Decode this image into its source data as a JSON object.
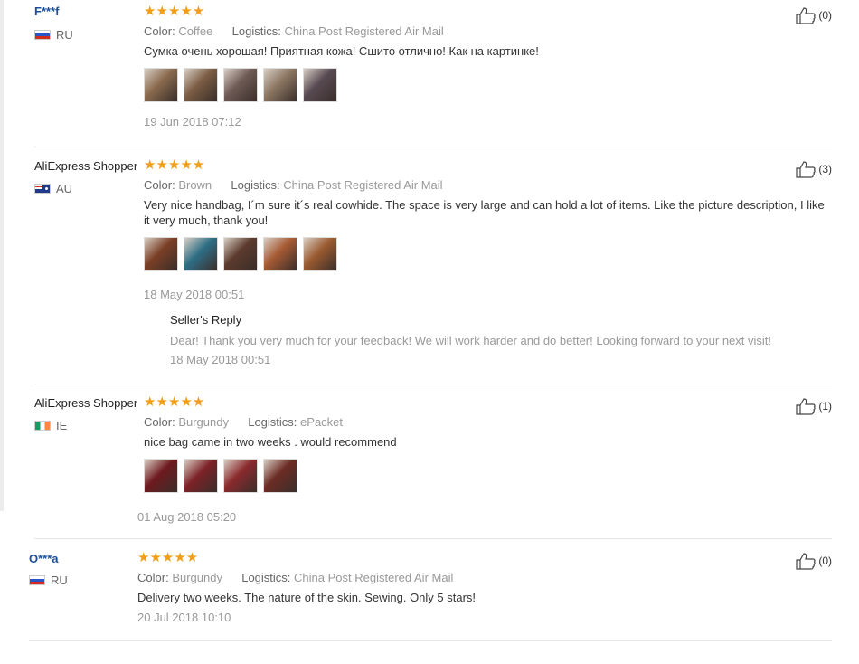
{
  "labels": {
    "color": "Color:",
    "logistics": "Logistics:"
  },
  "reviews": [
    {
      "user": "F***f",
      "country": "RU",
      "stars": "★★★★★",
      "color": "Coffee",
      "logistics": "China Post Registered Air Mail",
      "content": "Сумка очень хорошая! Приятная кожа! Сшито отлично! Как на картинке!",
      "date": "19 Jun 2018 07:12",
      "likes": "(0)",
      "photos": [
        "#8a6a4e",
        "#7b5c43",
        "#6e5a55",
        "#8c7763",
        "#584a52"
      ]
    },
    {
      "user": "AliExpress Shopper",
      "country": "AU",
      "stars": "★★★★★",
      "color": "Brown",
      "logistics": "China Post Registered Air Mail",
      "content": "Very nice handbag, I´m sure it´s real cowhide. The space is very large and can hold a lot of items. Like the picture description, I like it very much, thank you!",
      "date": "18 May 2018 00:51",
      "likes": "(3)",
      "photos": [
        "#7a3f25",
        "#2e6f86",
        "#5b3a2c",
        "#a55a33",
        "#9b5b30"
      ],
      "seller_reply": {
        "title": "Seller's Reply",
        "text": "Dear! Thank you very much for your feedback! We will work harder and do better! Looking forward to your next visit!",
        "date": "18 May 2018 00:51"
      }
    },
    {
      "user": "AliExpress Shopper",
      "country": "IE",
      "stars": "★★★★★",
      "color": "Burgundy",
      "logistics": "ePacket",
      "content": "nice bag came in two weeks . would recommend",
      "date": "01 Aug 2018 05:20",
      "likes": "(1)",
      "photos": [
        "#6e1a1f",
        "#7d2228",
        "#8a2a2d",
        "#6b2c24"
      ]
    },
    {
      "user": "O***a",
      "country": "RU",
      "stars": "★★★★★",
      "color": "Burgundy",
      "logistics": "China Post Registered Air Mail",
      "content": "Delivery two weeks. The nature of the skin. Sewing. Only 5 stars!",
      "date": "20 Jul 2018 10:10",
      "likes": "(0)"
    }
  ],
  "icons": {
    "flag_ru": "flag-ru-icon",
    "flag_au": "flag-au-icon",
    "flag_ie": "flag-ie-icon",
    "like": "thumbs-up-icon",
    "star": "star-icon"
  },
  "colors": {
    "star": "#f29f18",
    "masked_user": "#1a4f9c"
  }
}
